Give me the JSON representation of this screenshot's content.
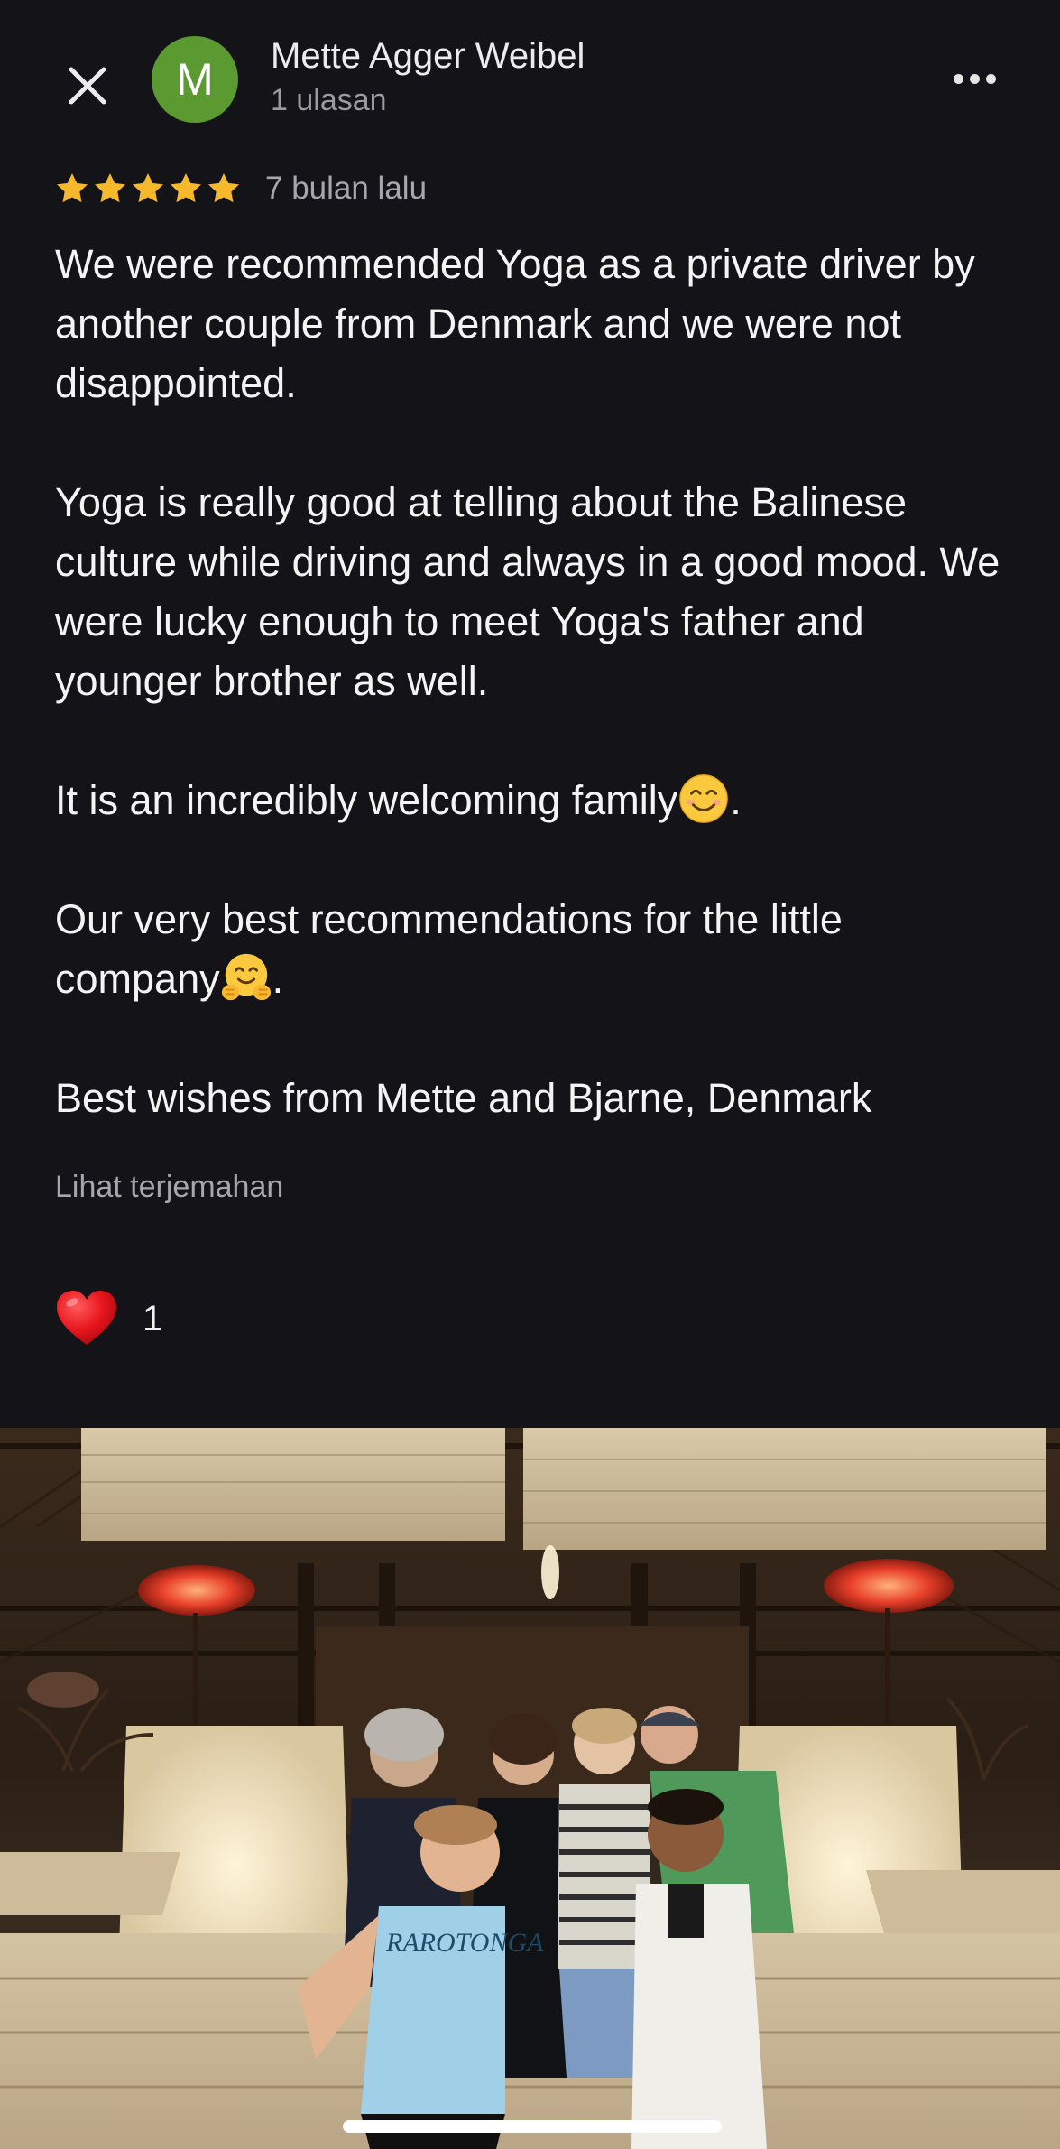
{
  "header": {
    "close_icon": "close-icon",
    "avatar_letter": "M",
    "avatar_color": "#5a9a31",
    "author_name": "Mette Agger Weibel",
    "author_review_count": "1 ulasan",
    "more_icon": "more-horizontal-icon"
  },
  "review": {
    "rating": 5,
    "rating_max": 5,
    "star_color": "#f6b92b",
    "date": "7 bulan lalu",
    "paragraphs": [
      "We were recommended Yoga as a private driver by another couple from Denmark and we were not disappointed.",
      "Yoga is really good at telling about the Balinese culture while driving and always in a good mood. We were lucky enough to meet Yoga's father and younger brother as well.",
      "It is an incredibly welcoming family",
      "Our very best recommendations for the little company",
      "Best wishes from Mette and Bjarne, Denmark"
    ],
    "paragraph_3_suffix": ".",
    "paragraph_4_suffix": ".",
    "emoji_smile": "smiling-face-icon",
    "emoji_hug": "hugging-face-icon",
    "translate_label": "Lihat terjemahan"
  },
  "reactions": {
    "icon": "heart-icon",
    "count": "1"
  },
  "photo": {
    "description": "group-photo",
    "shirt_text": "RAROTONGA"
  },
  "colors": {
    "background": "#141418",
    "text_primary": "#f4f4f4",
    "text_secondary": "#a6a6ac"
  }
}
